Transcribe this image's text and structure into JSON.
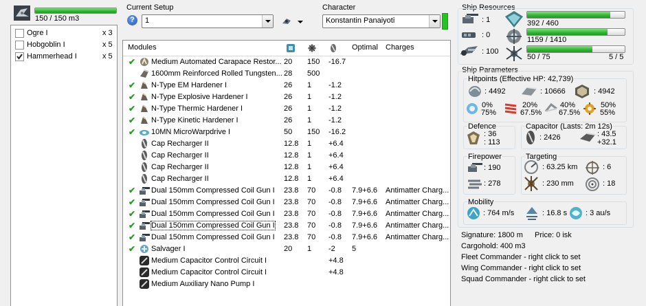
{
  "ship": {
    "capacity_text": "150 / 150 m3",
    "capacity_fraction": 1.0
  },
  "drones": [
    {
      "name": "Ogre I",
      "qty": "x 3",
      "checked": false
    },
    {
      "name": "Hobgoblin I",
      "qty": "x 5",
      "checked": false
    },
    {
      "name": "Hammerhead I",
      "qty": "x 5",
      "checked": true
    }
  ],
  "setup": {
    "label": "Current Setup",
    "value": "1",
    "help": "?"
  },
  "character": {
    "label": "Character",
    "value": "Konstantin Panaiyoti"
  },
  "modules_table": {
    "headers": [
      "Modules",
      "",
      "",
      "",
      "Optimal",
      "Charges"
    ],
    "rows": [
      {
        "online": true,
        "icon": "armor-repairer-icon",
        "name": "Medium Automated Carapace Restor...",
        "cpu": "20",
        "pg": "150",
        "cap": "-16.7",
        "optimal": "",
        "charges": ""
      },
      {
        "online": false,
        "icon": "armor-plate-icon",
        "name": "1600mm Reinforced Rolled Tungsten...",
        "cpu": "28",
        "pg": "500",
        "cap": "",
        "optimal": "",
        "charges": ""
      },
      {
        "online": true,
        "icon": "hardener-icon",
        "name": "N-Type EM Hardener I",
        "cpu": "26",
        "pg": "1",
        "cap": "-1.2",
        "optimal": "",
        "charges": ""
      },
      {
        "online": true,
        "icon": "hardener-icon",
        "name": "N-Type Explosive Hardener I",
        "cpu": "26",
        "pg": "1",
        "cap": "-1.2",
        "optimal": "",
        "charges": ""
      },
      {
        "online": true,
        "icon": "hardener-icon",
        "name": "N-Type Thermic Hardener I",
        "cpu": "26",
        "pg": "1",
        "cap": "-1.2",
        "optimal": "",
        "charges": ""
      },
      {
        "online": true,
        "icon": "hardener-icon",
        "name": "N-Type Kinetic Hardener I",
        "cpu": "26",
        "pg": "1",
        "cap": "-1.2",
        "optimal": "",
        "charges": ""
      },
      {
        "online": true,
        "icon": "microwarpdrive-icon",
        "name": "10MN MicroWarpdrive I",
        "cpu": "50",
        "pg": "150",
        "cap": "-16.2",
        "optimal": "",
        "charges": ""
      },
      {
        "online": false,
        "icon": "cap-recharger-icon",
        "name": "Cap Recharger II",
        "cpu": "12.8",
        "pg": "1",
        "cap": "+6.4",
        "optimal": "",
        "charges": ""
      },
      {
        "online": false,
        "icon": "cap-recharger-icon",
        "name": "Cap Recharger II",
        "cpu": "12.8",
        "pg": "1",
        "cap": "+6.4",
        "optimal": "",
        "charges": ""
      },
      {
        "online": false,
        "icon": "cap-recharger-icon",
        "name": "Cap Recharger II",
        "cpu": "12.8",
        "pg": "1",
        "cap": "+6.4",
        "optimal": "",
        "charges": ""
      },
      {
        "online": false,
        "icon": "cap-recharger-icon",
        "name": "Cap Recharger II",
        "cpu": "12.8",
        "pg": "1",
        "cap": "+6.4",
        "optimal": "",
        "charges": ""
      },
      {
        "online": true,
        "icon": "hybrid-gun-icon",
        "name": "Dual 150mm Compressed Coil Gun I",
        "cpu": "23.8",
        "pg": "70",
        "cap": "-0.8",
        "optimal": "7.9+6.6",
        "charges": "Antimatter Charg..."
      },
      {
        "online": true,
        "icon": "hybrid-gun-icon",
        "name": "Dual 150mm Compressed Coil Gun I",
        "cpu": "23.8",
        "pg": "70",
        "cap": "-0.8",
        "optimal": "7.9+6.6",
        "charges": "Antimatter Charg..."
      },
      {
        "online": true,
        "icon": "hybrid-gun-icon",
        "name": "Dual 150mm Compressed Coil Gun I",
        "cpu": "23.8",
        "pg": "70",
        "cap": "-0.8",
        "optimal": "7.9+6.6",
        "charges": "Antimatter Charg..."
      },
      {
        "online": true,
        "icon": "hybrid-gun-icon",
        "name": "Dual 150mm Compressed Coil Gun I",
        "cpu": "23.8",
        "pg": "70",
        "cap": "-0.8",
        "optimal": "7.9+6.6",
        "charges": "Antimatter Charg...",
        "selected": true
      },
      {
        "online": true,
        "icon": "hybrid-gun-icon",
        "name": "Dual 150mm Compressed Coil Gun I",
        "cpu": "23.8",
        "pg": "70",
        "cap": "-0.8",
        "optimal": "7.9+6.6",
        "charges": "Antimatter Charg..."
      },
      {
        "online": true,
        "icon": "salvager-icon",
        "name": "Salvager I",
        "cpu": "20",
        "pg": "1",
        "cap": "-2",
        "optimal": "5",
        "charges": ""
      },
      {
        "online": false,
        "icon": "rig-icon",
        "name": "Medium Capacitor Control Circuit I",
        "cpu": "",
        "pg": "",
        "cap": "+4.8",
        "optimal": "",
        "charges": ""
      },
      {
        "online": false,
        "icon": "rig-icon",
        "name": "Medium Capacitor Control Circuit I",
        "cpu": "",
        "pg": "",
        "cap": "+4.8",
        "optimal": "",
        "charges": ""
      },
      {
        "online": false,
        "icon": "rig-icon",
        "name": "Medium Auxiliary Nano Pump I",
        "cpu": "",
        "pg": "",
        "cap": "",
        "optimal": "",
        "charges": ""
      }
    ]
  },
  "ship_resources": {
    "label": "Ship Resources",
    "hardpoints": [
      {
        "icon": "turret-hardpoint-icon",
        "value": ": 1"
      },
      {
        "icon": "launcher-hardpoint-icon",
        "value": ": 0"
      },
      {
        "icon": "calibration-icon",
        "value": ": 100"
      }
    ],
    "bars": [
      {
        "icon": "cpu-icon",
        "text": "392 / 460",
        "fraction": 0.852,
        "right_text": ""
      },
      {
        "icon": "powergrid-icon",
        "text": "1159 / 1410",
        "fraction": 0.822,
        "right_text": ""
      },
      {
        "icon": "drone-bay-icon",
        "text": "50 / 75",
        "fraction": 0.667,
        "right_text": "5 / 5"
      }
    ]
  },
  "ship_parameters": {
    "label": "Ship Parameters",
    "hitpoints_label": "Hitpoints (Effective HP: 42,739)",
    "hp": {
      "shield": ": 4492",
      "armor": ": 10666",
      "structure": ": 4942"
    },
    "resists": [
      {
        "icon": "em-resist-icon",
        "top": "0%",
        "bottom": "75%"
      },
      {
        "icon": "thermal-resist-icon",
        "top": "20%",
        "bottom": "67.5%"
      },
      {
        "icon": "kinetic-resist-icon",
        "top": "40%",
        "bottom": "67.5%"
      },
      {
        "icon": "explosive-resist-icon",
        "top": "50%",
        "bottom": "55%"
      }
    ],
    "defence": {
      "label": "Defence",
      "top": ": 36",
      "bottom": ": 113"
    },
    "capacitor": {
      "label": "Capacitor (Lasts: 2m 12s)",
      "amount": ": 2426",
      "delta_top": ": 43.5",
      "delta_bottom": "+32.1"
    },
    "firepower": {
      "label": "Firepower",
      "top": ": 190",
      "bottom": ": 278"
    },
    "targeting": {
      "label": "Targeting",
      "range": ": 63.25 km",
      "targets": ": 6",
      "scan": ": 230 mm",
      "sensor": ": 18"
    },
    "mobility": {
      "label": "Mobility",
      "speed": ": 764 m/s",
      "align": ": 16.8 s",
      "warp": ": 3 au/s"
    },
    "signature": "Signature: 1800 m",
    "price": "Price: 0 isk",
    "cargohold": "Cargohold: 400 m3",
    "commanders": [
      "Fleet Commander - right click to set",
      "Wing Commander - right click to set",
      "Squad Commander - right click to set"
    ]
  },
  "colors": {
    "accent_green": "#2fb52f",
    "check_green": "#2a9a2a",
    "panel_border": "#8e8f8f"
  }
}
